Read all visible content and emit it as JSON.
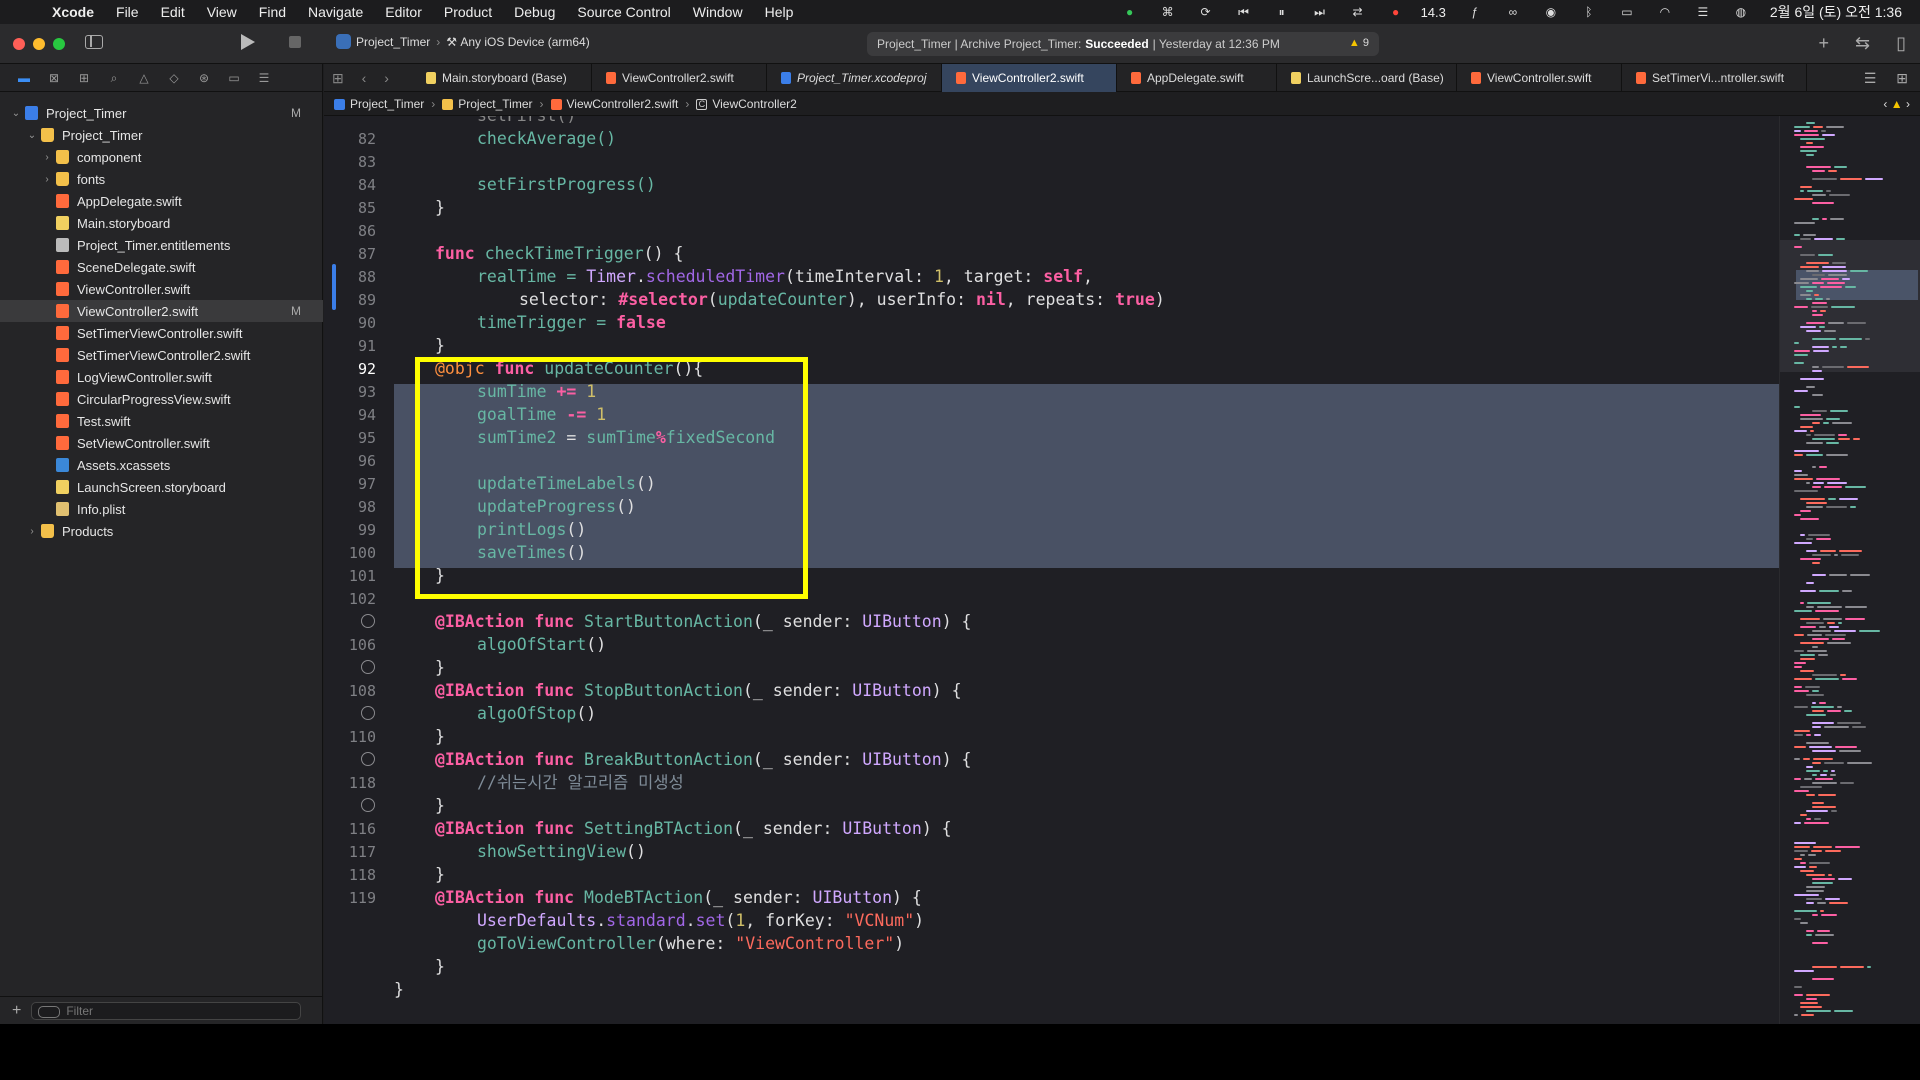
{
  "menubar": {
    "apple": "",
    "items": [
      "Xcode",
      "File",
      "Edit",
      "View",
      "Find",
      "Navigate",
      "Editor",
      "Product",
      "Debug",
      "Source Control",
      "Window",
      "Help"
    ],
    "cpu": "14.3",
    "clock": "2월 6일 (토) 오전 1:36"
  },
  "toolbar": {
    "scheme_project": "Project_Timer",
    "scheme_device": "Any iOS Device (arm64)",
    "activity_prefix": "Project_Timer | Archive Project_Timer:",
    "activity_status": "Succeeded",
    "activity_suffix": "| Yesterday at 12:36 PM",
    "warning_count": "9"
  },
  "navigator": {
    "filter_placeholder": "Filter",
    "items": [
      {
        "label": "Project_Timer",
        "badge": "M"
      },
      {
        "label": "Project_Timer"
      },
      {
        "label": "component"
      },
      {
        "label": "fonts"
      },
      {
        "label": "AppDelegate.swift"
      },
      {
        "label": "Main.storyboard"
      },
      {
        "label": "Project_Timer.entitlements"
      },
      {
        "label": "SceneDelegate.swift"
      },
      {
        "label": "ViewController.swift"
      },
      {
        "label": "ViewController2.swift",
        "badge": "M"
      },
      {
        "label": "SetTimerViewController.swift"
      },
      {
        "label": "SetTimerViewController2.swift"
      },
      {
        "label": "LogViewController.swift"
      },
      {
        "label": "CircularProgressView.swift"
      },
      {
        "label": "Test.swift"
      },
      {
        "label": "SetViewController.swift"
      },
      {
        "label": "Assets.xcassets"
      },
      {
        "label": "LaunchScreen.storyboard"
      },
      {
        "label": "Info.plist"
      },
      {
        "label": "Products"
      }
    ]
  },
  "tabs": [
    {
      "label": "Main.storyboard (Base)"
    },
    {
      "label": "ViewController2.swift"
    },
    {
      "label": "Project_Timer.xcodeproj"
    },
    {
      "label": "ViewController2.swift"
    },
    {
      "label": "AppDelegate.swift"
    },
    {
      "label": "LaunchScre...oard (Base)"
    },
    {
      "label": "ViewController.swift"
    },
    {
      "label": "SetTimerVi...ntroller.swift"
    }
  ],
  "jumpbar": {
    "crumbs": [
      "Project_Timer",
      "Project_Timer",
      "ViewController2.swift",
      "ViewController2"
    ],
    "class_badge": "C"
  },
  "editor": {
    "line_numbers": [
      "82",
      "83",
      "84",
      "85",
      "86",
      "87",
      "88",
      "89",
      "90",
      "91",
      "92",
      "93",
      "94",
      "95",
      "96",
      "97",
      "98",
      "99",
      "100",
      "101",
      "102",
      "",
      "106",
      "",
      "108",
      "",
      "110",
      "",
      "118",
      "",
      "116",
      "117",
      "118",
      "119"
    ],
    "code": {
      "l81": "setFirst()",
      "l82": "checkAverage()",
      "l84": "setFirstProgress()",
      "l85": "}",
      "l87_kw": "func",
      "l87_fn": "checkTimeTrigger",
      "l87_rest": "() {",
      "l88_a": "realTime = ",
      "l88_ty": "Timer",
      "l88_dot": ".",
      "l88_m": "scheduledTimer",
      "l88_b": "(timeInterval: ",
      "l88_n": "1",
      "l88_c": ", target: ",
      "l88_kw": "self",
      "l88_d": ",",
      "l89_a": "selector: ",
      "l89_kw": "#selector",
      "l89_b": "(",
      "l89_fn": "updateCounter",
      "l89_c": "), userInfo: ",
      "l89_kw2": "nil",
      "l89_d": ", repeats: ",
      "l89_kw3": "true",
      "l89_e": ")",
      "l90_a": "timeTrigger = ",
      "l90_kw": "false",
      "l91": "}",
      "l92_at": "@objc",
      "l92_kw": "func",
      "l92_fn": "updateCounter",
      "l92_rest": "(){",
      "l93_a": "sumTime",
      "l93_op": " += ",
      "l93_n": "1",
      "l94_a": "goalTime",
      "l94_op": " -= ",
      "l94_n": "1",
      "l95_a": "sumTime2",
      "l95_b": " = ",
      "l95_c": "sumTime",
      "l95_op": "%",
      "l95_d": "fixedSecond",
      "l97": "updateTimeLabels",
      "l98": "updateProgress",
      "l99": "printLogs",
      "l100": "saveTimes",
      "paren": "()",
      "l101": "}",
      "ibaction": "@IBAction",
      "func": "func",
      "l103_fn": "StartButtonAction",
      "l103_b": "(_ sender: ",
      "uibutton": "UIButton",
      "l103_c": ") {",
      "l104": "algoOfStart",
      "l107_fn": "StopButtonAction",
      "l108": "algoOfStop",
      "l110_fn": "BreakButtonAction",
      "l111": "//쉬는시간 알고리즘 미생성",
      "l113_fn": "SettingBTAction",
      "l114": "showSettingView",
      "l116_fn": "ModeBTAction",
      "l117_a": "UserDefaults",
      "l117_b": ".",
      "l117_c": "standard",
      "l117_m": "set",
      "l117_d": "(",
      "l117_n": "1",
      "l117_e": ", forKey: ",
      "l117_s": "\"VCNum\"",
      "l118_fn": "goToViewController",
      "l118_b": "(where: ",
      "l118_s": "\"ViewController\"",
      "rbrace": "}",
      "close_paren": ")"
    }
  },
  "colors": {
    "keyword": "#fc5fa3",
    "function": "#67b7a4",
    "type": "#d0a8ff",
    "number": "#d0bf69",
    "string": "#fc6a5d",
    "highlight_box": "#ffff00",
    "selection": "#515b70"
  }
}
